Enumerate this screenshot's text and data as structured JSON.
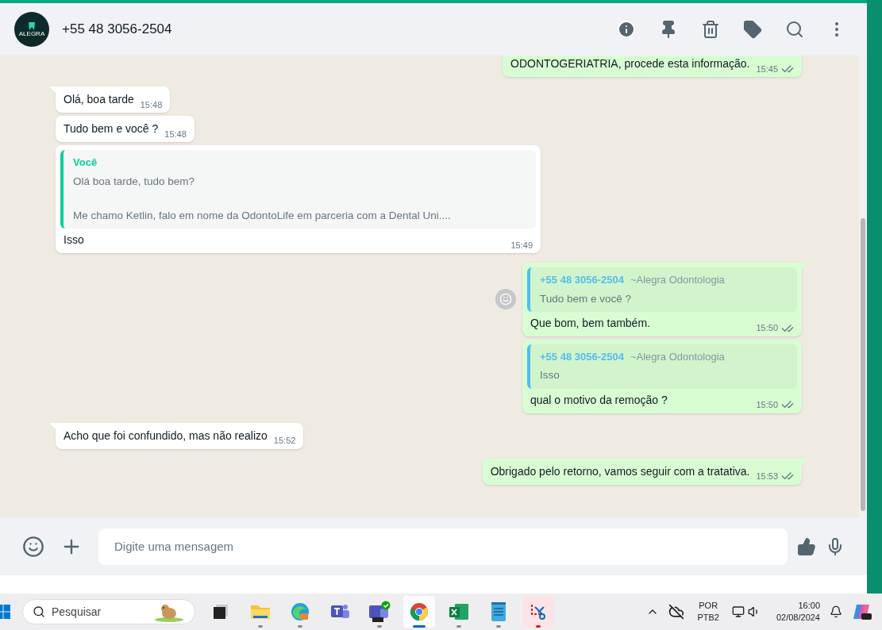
{
  "header": {
    "avatar_text": "ALEGRA",
    "contact": "+55 48 3056-2504"
  },
  "messages": [
    {
      "kind": "out",
      "tail": false,
      "text": "ODONTOGERIATRIA, procede esta informação.",
      "time": "15:45",
      "read": true
    },
    {
      "kind": "in",
      "tail": true,
      "text": "Olá, boa tarde",
      "time": "15:48"
    },
    {
      "kind": "in",
      "tail": false,
      "text": "Tudo bem e você ?",
      "time": "15:48"
    },
    {
      "kind": "in",
      "tail": false,
      "quote": {
        "author": "Você",
        "lines": [
          "Olá boa tarde, tudo bem?",
          "Me chamo Ketlin, falo em nome da OdontoLife em parceria com a Dental Uni...."
        ]
      },
      "text": "Isso",
      "time": "15:49"
    },
    {
      "kind": "out",
      "tail": true,
      "react": true,
      "quote": {
        "author": "+55 48 3056-2504",
        "alias": "~Alegra Odontologia",
        "lines": [
          "Tudo bem e você ?"
        ]
      },
      "text": "Que bom, bem também.",
      "time": "15:50",
      "read": true
    },
    {
      "kind": "out",
      "tail": false,
      "quote": {
        "author": "+55 48 3056-2504",
        "alias": "~Alegra Odontologia",
        "lines": [
          "Isso"
        ]
      },
      "text": "qual o motivo da remoção ?",
      "time": "15:50",
      "read": true
    },
    {
      "kind": "in",
      "tail": true,
      "text": "Acho que foi confundido, mas não realizo",
      "time": "15:52"
    },
    {
      "kind": "out",
      "tail": true,
      "text": "Obrigado pelo retorno, vamos seguir com a tratativa.",
      "time": "15:53",
      "read": true
    }
  ],
  "composer": {
    "placeholder": "Digite uma mensagem"
  },
  "taskbar": {
    "search_placeholder": "Pesquisar",
    "apps": [
      {
        "kind": "taskview",
        "selected": false,
        "running": false
      },
      {
        "kind": "folder",
        "selected": false,
        "running": true
      },
      {
        "kind": "edge",
        "selected": false,
        "running": true
      },
      {
        "kind": "teams",
        "selected": false,
        "running": false
      },
      {
        "kind": "teamsnew",
        "selected": false,
        "running": true
      },
      {
        "kind": "chrome",
        "selected": true,
        "running": true
      },
      {
        "kind": "excel",
        "selected": false,
        "running": true
      },
      {
        "kind": "notepad",
        "selected": false,
        "running": true
      },
      {
        "kind": "snip",
        "selected": false,
        "running": true
      }
    ],
    "lang": "POR",
    "layout": "PTB2",
    "time": "16:00",
    "date": "02/08/2024"
  }
}
